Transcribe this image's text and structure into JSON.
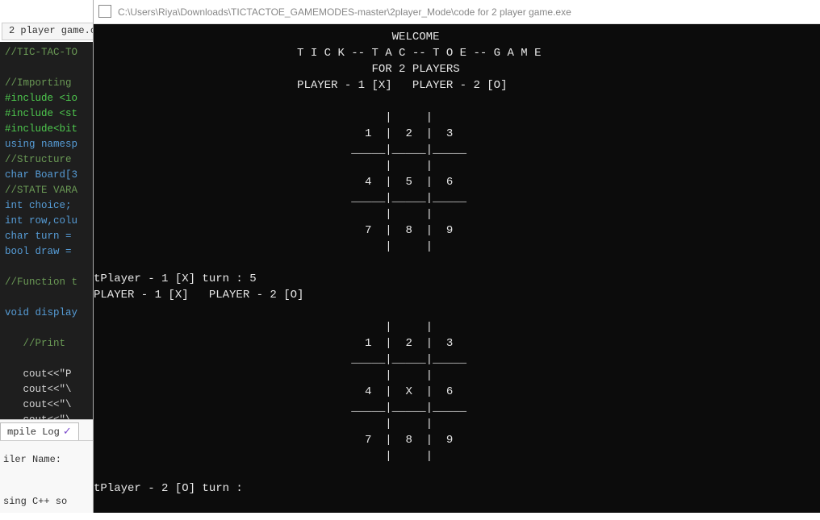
{
  "ide": {
    "tab_label": "2 player game.c",
    "editor_lines": [
      {
        "cls": "c-comment",
        "text": "//TIC-TAC-TO"
      },
      {
        "cls": "",
        "text": " "
      },
      {
        "cls": "c-comment",
        "text": "//Importing "
      },
      {
        "cls": "c-green",
        "text": "#include <io"
      },
      {
        "cls": "c-green",
        "text": "#include <st"
      },
      {
        "cls": "c-green",
        "text": "#include<bit"
      },
      {
        "cls": "c-keyword",
        "text": "using namesp"
      },
      {
        "cls": "c-comment",
        "text": "//Structure "
      },
      {
        "cls": "c-keyword",
        "text": "char Board[3"
      },
      {
        "cls": "c-comment",
        "text": "//STATE VARA"
      },
      {
        "cls": "c-keyword",
        "text": "int choice;"
      },
      {
        "cls": "c-keyword",
        "text": "int row,colu"
      },
      {
        "cls": "c-keyword",
        "text": "char turn = "
      },
      {
        "cls": "c-keyword",
        "text": "bool draw = "
      },
      {
        "cls": "",
        "text": " "
      },
      {
        "cls": "c-comment",
        "text": "//Function t"
      },
      {
        "cls": "",
        "text": " "
      },
      {
        "cls": "c-keyword",
        "text": "void display"
      },
      {
        "cls": "",
        "text": " "
      },
      {
        "cls": "c-comment",
        "text": "   //Print "
      },
      {
        "cls": "",
        "text": " "
      },
      {
        "cls": "c-white",
        "text": "   cout<<\"P"
      },
      {
        "cls": "c-white",
        "text": "   cout<<\"\\"
      },
      {
        "cls": "c-white",
        "text": "   cout<<\"\\"
      },
      {
        "cls": "c-white",
        "text": "   cout<<\"\\"
      }
    ],
    "bottom_tab_label": "mpile Log",
    "compiler_name_label": "iler Name:",
    "compiler_cmd": "sing C++ so"
  },
  "console": {
    "title": "C:\\Users\\Riya\\Downloads\\TICTACTOE_GAMEMODES-master\\2player_Mode\\code for 2 player game.exe",
    "lines": [
      "                                            WELCOME",
      "                              T I C K -- T A C -- T O E -- G A M E",
      "                                         FOR 2 PLAYERS",
      "                              PLAYER - 1 [X]   PLAYER - 2 [O]",
      "",
      "                                           |     |     ",
      "                                        1  |  2  |  3  ",
      "                                      _____|_____|_____",
      "                                           |     |     ",
      "                                        4  |  5  |  6  ",
      "                                      _____|_____|_____",
      "                                           |     |     ",
      "                                        7  |  8  |  9  ",
      "                                           |     |     ",
      "",
      "tPlayer - 1 [X] turn : 5",
      "PLAYER - 1 [X]   PLAYER - 2 [O]",
      "",
      "                                           |     |     ",
      "                                        1  |  2  |  3  ",
      "                                      _____|_____|_____",
      "                                           |     |     ",
      "                                        4  |  X  |  6  ",
      "                                      _____|_____|_____",
      "                                           |     |     ",
      "                                        7  |  8  |  9  ",
      "                                           |     |     ",
      "",
      "tPlayer - 2 [O] turn :"
    ]
  }
}
